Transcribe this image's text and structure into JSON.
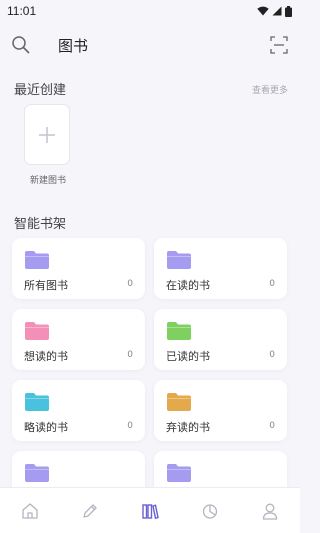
{
  "status": {
    "time": "11:01"
  },
  "header": {
    "title": "图书"
  },
  "recent": {
    "title": "最近创建",
    "more": "查看更多",
    "new_book": "新建图书"
  },
  "shelf": {
    "title": "智能书架",
    "cards": [
      {
        "label": "所有图书",
        "count": "0",
        "color": "#a59bf0"
      },
      {
        "label": "在读的书",
        "count": "0",
        "color": "#a59bf0"
      },
      {
        "label": "想读的书",
        "count": "0",
        "color": "#f48fb8"
      },
      {
        "label": "已读的书",
        "count": "0",
        "color": "#7ed15e"
      },
      {
        "label": "略读的书",
        "count": "0",
        "color": "#49c2de"
      },
      {
        "label": "弃读的书",
        "count": "0",
        "color": "#e3a94c"
      },
      {
        "label": "",
        "count": "",
        "color": "#a59bf0"
      },
      {
        "label": "",
        "count": "",
        "color": "#a59bf0"
      }
    ]
  },
  "tabs": [
    {
      "icon": "home-icon",
      "active": false
    },
    {
      "icon": "pencil-icon",
      "active": false
    },
    {
      "icon": "books-icon",
      "active": true
    },
    {
      "icon": "pie-chart-icon",
      "active": false
    },
    {
      "icon": "user-icon",
      "active": false
    }
  ],
  "colors": {
    "accent": "#6b5fd3",
    "inactive": "#b4b4c0"
  }
}
